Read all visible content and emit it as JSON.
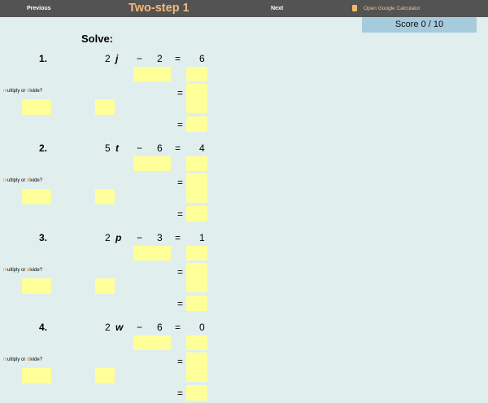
{
  "topbar": {
    "previous_label": "Previous",
    "title": "Two-step 1",
    "next_label": "Next",
    "calculator_label": "Open Google Calculator"
  },
  "score": {
    "label": "Score 0 / 10"
  },
  "heading": "Solve:",
  "md_label": {
    "m": "m",
    "ultiply": "ultiply or ",
    "d": "d",
    "ivide": "ivide?"
  },
  "problems": [
    {
      "number": "1.",
      "coef": "2",
      "var": "j",
      "op": "−",
      "const": "2",
      "eq": "=",
      "rhs": "6"
    },
    {
      "number": "2.",
      "coef": "5",
      "var": "t",
      "op": "−",
      "const": "6",
      "eq": "=",
      "rhs": "4"
    },
    {
      "number": "3.",
      "coef": "2",
      "var": "p",
      "op": "−",
      "const": "3",
      "eq": "=",
      "rhs": "1"
    },
    {
      "number": "4.",
      "coef": "2",
      "var": "w",
      "op": "−",
      "const": "6",
      "eq": "=",
      "rhs": "0"
    }
  ],
  "colors": {
    "background": "#e1eeee",
    "topbar": "#535353",
    "title": "#f5b97e",
    "input": "#ffff99",
    "score_bg": "#a6cbdc"
  }
}
